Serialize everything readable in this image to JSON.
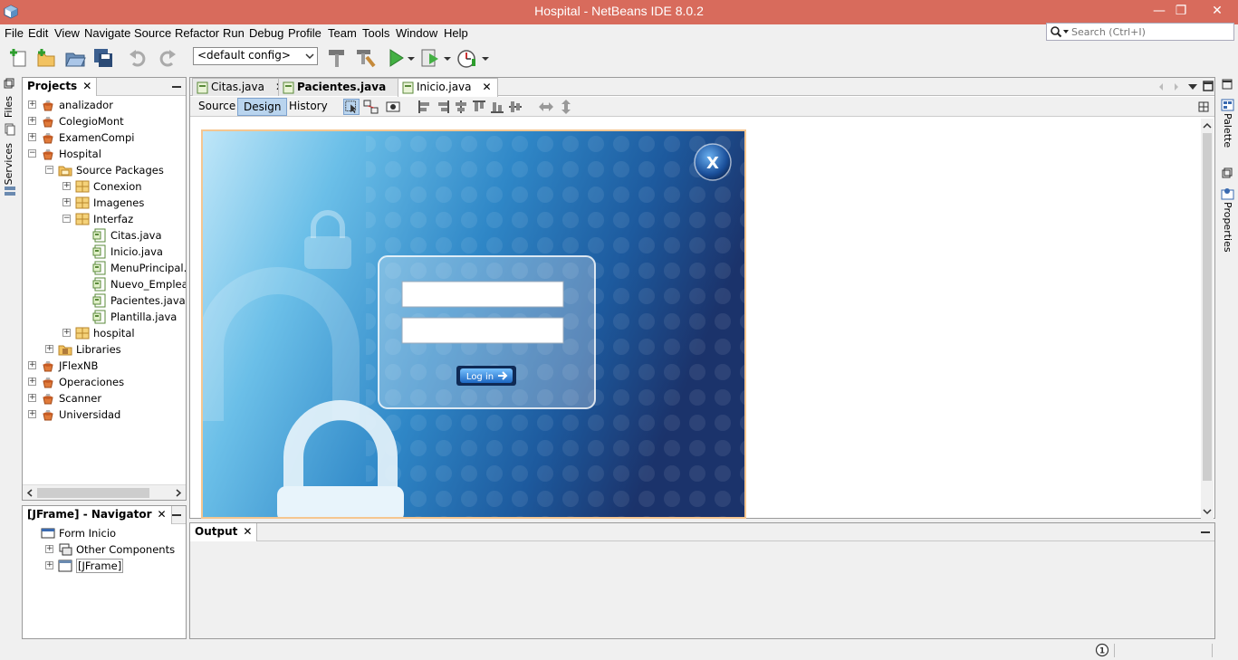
{
  "window": {
    "title": "Hospital - NetBeans IDE 8.0.2",
    "minimize": "—",
    "restore": "❐",
    "close": "✕"
  },
  "menu": [
    "File",
    "Edit",
    "View",
    "Navigate",
    "Source",
    "Refactor",
    "Run",
    "Debug",
    "Profile",
    "Team",
    "Tools",
    "Window",
    "Help"
  ],
  "search": {
    "placeholder": "Search (Ctrl+I)"
  },
  "toolbar": {
    "config": "<default config>",
    "icons": [
      "new-file-icon",
      "new-project-icon",
      "open-project-icon",
      "save-all-icon",
      "undo-icon",
      "redo-icon",
      "build-hammer-icon",
      "clean-build-icon",
      "run-icon",
      "debug-icon",
      "profile-icon"
    ]
  },
  "left_strip": {
    "files": "Files",
    "services": "Services"
  },
  "right_strip": {
    "palette": "Palette",
    "properties": "Properties"
  },
  "projects": {
    "tab": "Projects",
    "close": "✕",
    "tree": [
      {
        "label": "analizador",
        "level": 0,
        "type": "project",
        "exp": "+"
      },
      {
        "label": "ColegioMont",
        "level": 0,
        "type": "project",
        "exp": "+"
      },
      {
        "label": "ExamenCompi",
        "level": 0,
        "type": "project",
        "exp": "+"
      },
      {
        "label": "Hospital",
        "level": 0,
        "type": "project",
        "exp": "−"
      },
      {
        "label": "Source Packages",
        "level": 1,
        "type": "srcpkg",
        "exp": "−"
      },
      {
        "label": "Conexion",
        "level": 2,
        "type": "package",
        "exp": "+"
      },
      {
        "label": "Imagenes",
        "level": 2,
        "type": "package",
        "exp": "+"
      },
      {
        "label": "Interfaz",
        "level": 2,
        "type": "package",
        "exp": "−"
      },
      {
        "label": "Citas.java",
        "level": 3,
        "type": "form",
        "exp": ""
      },
      {
        "label": "Inicio.java",
        "level": 3,
        "type": "form",
        "exp": ""
      },
      {
        "label": "MenuPrincipal.java",
        "level": 3,
        "type": "form",
        "exp": ""
      },
      {
        "label": "Nuevo_Empleado.java",
        "level": 3,
        "type": "form",
        "exp": ""
      },
      {
        "label": "Pacientes.java",
        "level": 3,
        "type": "form",
        "exp": ""
      },
      {
        "label": "Plantilla.java",
        "level": 3,
        "type": "form",
        "exp": ""
      },
      {
        "label": "hospital",
        "level": 2,
        "type": "package",
        "exp": "+"
      },
      {
        "label": "Libraries",
        "level": 1,
        "type": "library",
        "exp": "+"
      },
      {
        "label": "JFlexNB",
        "level": 0,
        "type": "project",
        "exp": "+"
      },
      {
        "label": "Operaciones",
        "level": 0,
        "type": "project",
        "exp": "+"
      },
      {
        "label": "Scanner",
        "level": 0,
        "type": "project",
        "exp": "+"
      },
      {
        "label": "Universidad",
        "level": 0,
        "type": "project",
        "exp": "+"
      }
    ]
  },
  "navigator": {
    "tab": "[JFrame] - Navigator",
    "close": "✕",
    "tree": [
      {
        "label": "Form Inicio",
        "level": 0,
        "exp": ""
      },
      {
        "label": "Other Components",
        "level": 1,
        "exp": "+"
      },
      {
        "label": "[JFrame]",
        "level": 1,
        "exp": "+"
      }
    ]
  },
  "editor": {
    "tabs": [
      {
        "label": "Citas.java",
        "active": false
      },
      {
        "label": "Pacientes.java",
        "active": false,
        "bold": true
      },
      {
        "label": "Inicio.java",
        "active": true
      }
    ],
    "views": [
      "Source",
      "Design",
      "History"
    ],
    "active_view": "Design"
  },
  "login_form": {
    "close_glyph": "X",
    "button": "Log in"
  },
  "output": {
    "tab": "Output",
    "close": "✕"
  },
  "status": {
    "notifications": "1"
  },
  "colors": {
    "titlebar": "#d86b5c",
    "accent": "#b9d4ee"
  }
}
